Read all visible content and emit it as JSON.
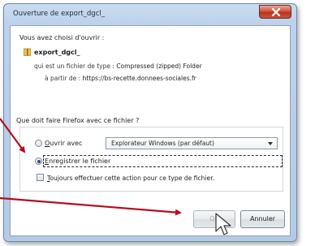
{
  "dialog": {
    "title": "Ouverture de export_dgcl_",
    "intro": "Vous avez choisi d'ouvrir :",
    "file_name": "export_dgcl_",
    "type_label": "qui est un fichier de type :",
    "type_value": "Compressed (zipped) Folder",
    "from_label": "à partir de :",
    "from_value": "https://bs-recette.donnees-sociales.fr",
    "question": "Que doit faire Firefox avec ce fichier ?",
    "open_with_label_prefix": "",
    "open_with_mnemonic": "O",
    "open_with_label_rest": "uvrir avec",
    "open_with_app": "Explorateur Windows (par défaut)",
    "save_mnemonic": "E",
    "save_label_rest": "nregistrer le fichier",
    "always_mnemonic": "T",
    "always_label_rest": "oujours effectuer cette action pour ce type de fichier.",
    "ok_label": "OK",
    "cancel_label": "Annuler"
  },
  "state": {
    "selected_option": "save",
    "always_checked": false,
    "ok_enabled": false
  },
  "colors": {
    "annotation_arrow": "#b30f1f",
    "close_button": "#c8533c"
  },
  "icons": {
    "close": "close-icon",
    "file": "zip-file-icon",
    "cursor": "mouse-cursor-icon"
  }
}
